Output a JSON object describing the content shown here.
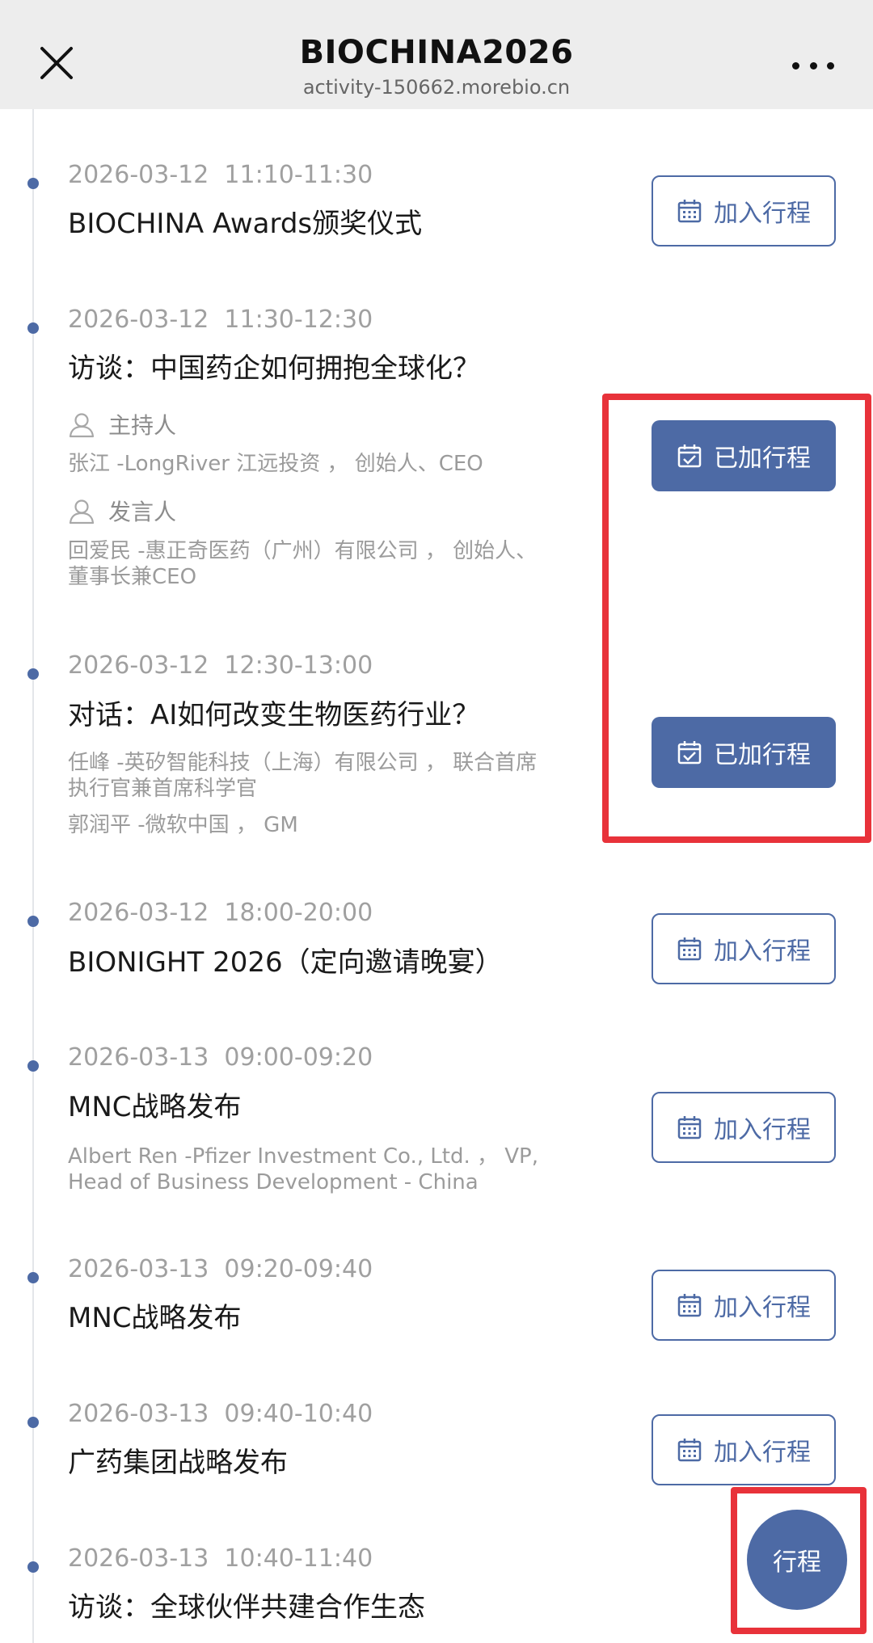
{
  "titlebar": {
    "title": "BIOCHINA2026",
    "url": "activity-150662.morebio.cn"
  },
  "buttons": {
    "add_label": "加入行程",
    "added_label": "已加行程",
    "schedule_fab": "行程"
  },
  "events": [
    {
      "time": "2026-03-12  11:10-11:30",
      "title": "BIOCHINA Awards颁奖仪式",
      "status": "add"
    },
    {
      "time": "2026-03-12  11:30-12:30",
      "title": "访谈：中国药企如何拥抱全球化？",
      "host_label": "主持人",
      "host": "张江 -LongRiver 江远投资 ， 创始人、CEO",
      "speaker_label": "发言人",
      "speaker_line1": "回爱民 -惠正奇医药（广州）有限公司 ， 创始人、",
      "speaker_line2": "董事长兼CEO",
      "status": "added"
    },
    {
      "time": "2026-03-12  12:30-13:00",
      "title": "对话：AI如何改变生物医药行业？",
      "line1": "任峰 -英矽智能科技（上海）有限公司 ， 联合首席",
      "line2": "执行官兼首席科学官",
      "line3": "郭润平 -微软中国 ， GM",
      "status": "added"
    },
    {
      "time": "2026-03-12  18:00-20:00",
      "title": "BIONIGHT 2026（定向邀请晚宴）",
      "status": "add"
    },
    {
      "time": "2026-03-13  09:00-09:20",
      "title": "MNC战略发布",
      "line1": "Albert Ren -Pfizer Investment Co., Ltd. ， VP,",
      "line2": "Head of Business Development - China",
      "status": "add"
    },
    {
      "time": "2026-03-13  09:20-09:40",
      "title": "MNC战略发布",
      "status": "add"
    },
    {
      "time": "2026-03-13  09:40-10:40",
      "title": "广药集团战略发布",
      "status": "add"
    },
    {
      "time": "2026-03-13  10:40-11:40",
      "title": "访谈：全球伙伴共建合作生态"
    }
  ],
  "colors": {
    "accent": "#4d6aa5",
    "highlight": "#e8323a",
    "titlebar_bg": "#ededed",
    "muted_text": "#9b9b9b"
  },
  "icons": [
    "close-icon",
    "more-icon",
    "calendar-icon",
    "calendar-check-icon",
    "person-icon"
  ]
}
